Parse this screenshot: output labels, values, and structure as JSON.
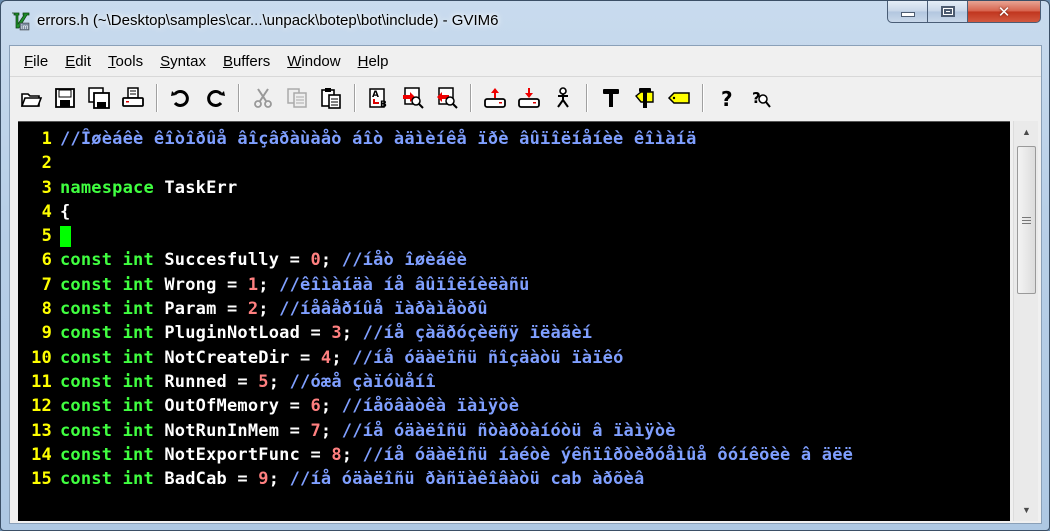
{
  "window": {
    "title": "errors.h (~\\Desktop\\samples\\car...\\unpack\\botep\\bot\\include) - GVIM6",
    "app_icon": "vim-icon",
    "caption_buttons": {
      "minimize": "minimize-icon",
      "maximize": "maximize-icon",
      "close": "✕"
    }
  },
  "menubar": {
    "items": [
      {
        "label": "File",
        "accel": "F",
        "rest": "ile"
      },
      {
        "label": "Edit",
        "accel": "E",
        "rest": "dit"
      },
      {
        "label": "Tools",
        "accel": "T",
        "rest": "ools"
      },
      {
        "label": "Syntax",
        "accel": "S",
        "rest": "yntax"
      },
      {
        "label": "Buffers",
        "accel": "B",
        "rest": "uffers"
      },
      {
        "label": "Window",
        "accel": "W",
        "rest": "indow"
      },
      {
        "label": "Help",
        "accel": "H",
        "rest": "elp"
      }
    ]
  },
  "toolbar": {
    "groups": [
      [
        "open-icon",
        "save-icon",
        "save-all-icon",
        "print-icon"
      ],
      [
        "undo-icon",
        "redo-icon"
      ],
      [
        "cut-icon",
        "copy-icon",
        "paste-icon"
      ],
      [
        "replace-icon",
        "find-next-icon",
        "find-prev-icon"
      ],
      [
        "load-session-icon",
        "save-session-icon",
        "run-script-icon"
      ],
      [
        "make-icon",
        "build-tags-icon",
        "jump-tag-icon"
      ],
      [
        "help-icon",
        "find-help-icon"
      ]
    ]
  },
  "editor": {
    "colors": {
      "background": "#000000",
      "line_number": "#ffff00",
      "keyword": "#40ff40",
      "identifier": "#ffffff",
      "number": "#ff8080",
      "comment": "#7f9fff",
      "cursor": "#00ff00"
    },
    "lines": [
      {
        "n": "1",
        "kw": "",
        "name": "",
        "value": "",
        "comment": "//Îøèáêè êîòîðûå âîçâðàùàåò áîò àäìèíêå ïðè âûïîëíåíèè êîìàíä"
      },
      {
        "n": "2",
        "kw": "",
        "name": "",
        "value": "",
        "comment": ""
      },
      {
        "n": "3",
        "kw": "namespace",
        "name": "TaskErr",
        "value": "",
        "comment": ""
      },
      {
        "n": "4",
        "kw": "",
        "name": "{",
        "value": "",
        "comment": ""
      },
      {
        "n": "5",
        "kw": "",
        "name": "",
        "value": "",
        "comment": "",
        "cursor": true
      },
      {
        "n": "6",
        "kw": "const int",
        "name": "Succesfully",
        "value": "0",
        "comment": "//íåò îøèáêè"
      },
      {
        "n": "7",
        "kw": "const int",
        "name": "Wrong",
        "value": "1",
        "comment": "//êîìàíäà íå âûïîëíèëàñü"
      },
      {
        "n": "8",
        "kw": "const int",
        "name": "Param",
        "value": "2",
        "comment": "//íåâåðíûå ïàðàìåòðû"
      },
      {
        "n": "9",
        "kw": "const int",
        "name": "PluginNotLoad",
        "value": "3",
        "comment": "//íå çàãðóçèëñÿ ïëàãèí"
      },
      {
        "n": "10",
        "kw": "const int",
        "name": "NotCreateDir",
        "value": "4",
        "comment": "//íå óäàëîñü ñîçäàòü ïàïêó"
      },
      {
        "n": "11",
        "kw": "const int",
        "name": "Runned",
        "value": "5",
        "comment": "//óæå çàïóùåíî"
      },
      {
        "n": "12",
        "kw": "const int",
        "name": "OutOfMemory",
        "value": "6",
        "comment": "//íåõâàòêà ïàìÿòè"
      },
      {
        "n": "13",
        "kw": "const int",
        "name": "NotRunInMem",
        "value": "7",
        "comment": "//íå óäàëîñü ñòàðòàíóòü â ïàìÿòè"
      },
      {
        "n": "14",
        "kw": "const int",
        "name": "NotExportFunc",
        "value": "8",
        "comment": "//íå óäàëîñü íàéòè ýêñïîðòèðóåìûå ôóíêöèè â äëë"
      },
      {
        "n": "15",
        "kw": "const int",
        "name": "BadCab",
        "value": "9",
        "comment": "//íå óäàëîñü ðàñïàêîâàòü cab àðõèâ"
      }
    ]
  },
  "scrollbar": {
    "up": "▲",
    "down": "▼",
    "position_fraction": 0.0,
    "visible_fraction": 0.4
  }
}
